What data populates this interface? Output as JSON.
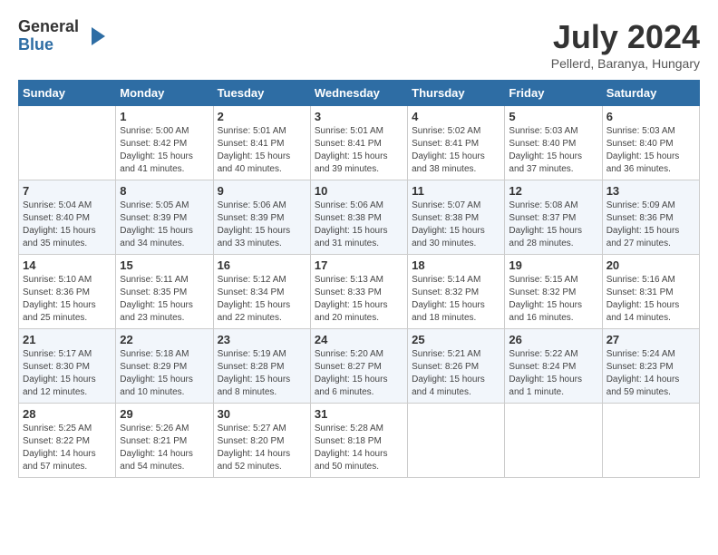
{
  "logo": {
    "general": "General",
    "blue": "Blue"
  },
  "title": "July 2024",
  "subtitle": "Pellerd, Baranya, Hungary",
  "days_of_week": [
    "Sunday",
    "Monday",
    "Tuesday",
    "Wednesday",
    "Thursday",
    "Friday",
    "Saturday"
  ],
  "weeks": [
    [
      {
        "day": "",
        "info": ""
      },
      {
        "day": "1",
        "info": "Sunrise: 5:00 AM\nSunset: 8:42 PM\nDaylight: 15 hours\nand 41 minutes."
      },
      {
        "day": "2",
        "info": "Sunrise: 5:01 AM\nSunset: 8:41 PM\nDaylight: 15 hours\nand 40 minutes."
      },
      {
        "day": "3",
        "info": "Sunrise: 5:01 AM\nSunset: 8:41 PM\nDaylight: 15 hours\nand 39 minutes."
      },
      {
        "day": "4",
        "info": "Sunrise: 5:02 AM\nSunset: 8:41 PM\nDaylight: 15 hours\nand 38 minutes."
      },
      {
        "day": "5",
        "info": "Sunrise: 5:03 AM\nSunset: 8:40 PM\nDaylight: 15 hours\nand 37 minutes."
      },
      {
        "day": "6",
        "info": "Sunrise: 5:03 AM\nSunset: 8:40 PM\nDaylight: 15 hours\nand 36 minutes."
      }
    ],
    [
      {
        "day": "7",
        "info": "Sunrise: 5:04 AM\nSunset: 8:40 PM\nDaylight: 15 hours\nand 35 minutes."
      },
      {
        "day": "8",
        "info": "Sunrise: 5:05 AM\nSunset: 8:39 PM\nDaylight: 15 hours\nand 34 minutes."
      },
      {
        "day": "9",
        "info": "Sunrise: 5:06 AM\nSunset: 8:39 PM\nDaylight: 15 hours\nand 33 minutes."
      },
      {
        "day": "10",
        "info": "Sunrise: 5:06 AM\nSunset: 8:38 PM\nDaylight: 15 hours\nand 31 minutes."
      },
      {
        "day": "11",
        "info": "Sunrise: 5:07 AM\nSunset: 8:38 PM\nDaylight: 15 hours\nand 30 minutes."
      },
      {
        "day": "12",
        "info": "Sunrise: 5:08 AM\nSunset: 8:37 PM\nDaylight: 15 hours\nand 28 minutes."
      },
      {
        "day": "13",
        "info": "Sunrise: 5:09 AM\nSunset: 8:36 PM\nDaylight: 15 hours\nand 27 minutes."
      }
    ],
    [
      {
        "day": "14",
        "info": "Sunrise: 5:10 AM\nSunset: 8:36 PM\nDaylight: 15 hours\nand 25 minutes."
      },
      {
        "day": "15",
        "info": "Sunrise: 5:11 AM\nSunset: 8:35 PM\nDaylight: 15 hours\nand 23 minutes."
      },
      {
        "day": "16",
        "info": "Sunrise: 5:12 AM\nSunset: 8:34 PM\nDaylight: 15 hours\nand 22 minutes."
      },
      {
        "day": "17",
        "info": "Sunrise: 5:13 AM\nSunset: 8:33 PM\nDaylight: 15 hours\nand 20 minutes."
      },
      {
        "day": "18",
        "info": "Sunrise: 5:14 AM\nSunset: 8:32 PM\nDaylight: 15 hours\nand 18 minutes."
      },
      {
        "day": "19",
        "info": "Sunrise: 5:15 AM\nSunset: 8:32 PM\nDaylight: 15 hours\nand 16 minutes."
      },
      {
        "day": "20",
        "info": "Sunrise: 5:16 AM\nSunset: 8:31 PM\nDaylight: 15 hours\nand 14 minutes."
      }
    ],
    [
      {
        "day": "21",
        "info": "Sunrise: 5:17 AM\nSunset: 8:30 PM\nDaylight: 15 hours\nand 12 minutes."
      },
      {
        "day": "22",
        "info": "Sunrise: 5:18 AM\nSunset: 8:29 PM\nDaylight: 15 hours\nand 10 minutes."
      },
      {
        "day": "23",
        "info": "Sunrise: 5:19 AM\nSunset: 8:28 PM\nDaylight: 15 hours\nand 8 minutes."
      },
      {
        "day": "24",
        "info": "Sunrise: 5:20 AM\nSunset: 8:27 PM\nDaylight: 15 hours\nand 6 minutes."
      },
      {
        "day": "25",
        "info": "Sunrise: 5:21 AM\nSunset: 8:26 PM\nDaylight: 15 hours\nand 4 minutes."
      },
      {
        "day": "26",
        "info": "Sunrise: 5:22 AM\nSunset: 8:24 PM\nDaylight: 15 hours\nand 1 minute."
      },
      {
        "day": "27",
        "info": "Sunrise: 5:24 AM\nSunset: 8:23 PM\nDaylight: 14 hours\nand 59 minutes."
      }
    ],
    [
      {
        "day": "28",
        "info": "Sunrise: 5:25 AM\nSunset: 8:22 PM\nDaylight: 14 hours\nand 57 minutes."
      },
      {
        "day": "29",
        "info": "Sunrise: 5:26 AM\nSunset: 8:21 PM\nDaylight: 14 hours\nand 54 minutes."
      },
      {
        "day": "30",
        "info": "Sunrise: 5:27 AM\nSunset: 8:20 PM\nDaylight: 14 hours\nand 52 minutes."
      },
      {
        "day": "31",
        "info": "Sunrise: 5:28 AM\nSunset: 8:18 PM\nDaylight: 14 hours\nand 50 minutes."
      },
      {
        "day": "",
        "info": ""
      },
      {
        "day": "",
        "info": ""
      },
      {
        "day": "",
        "info": ""
      }
    ]
  ]
}
